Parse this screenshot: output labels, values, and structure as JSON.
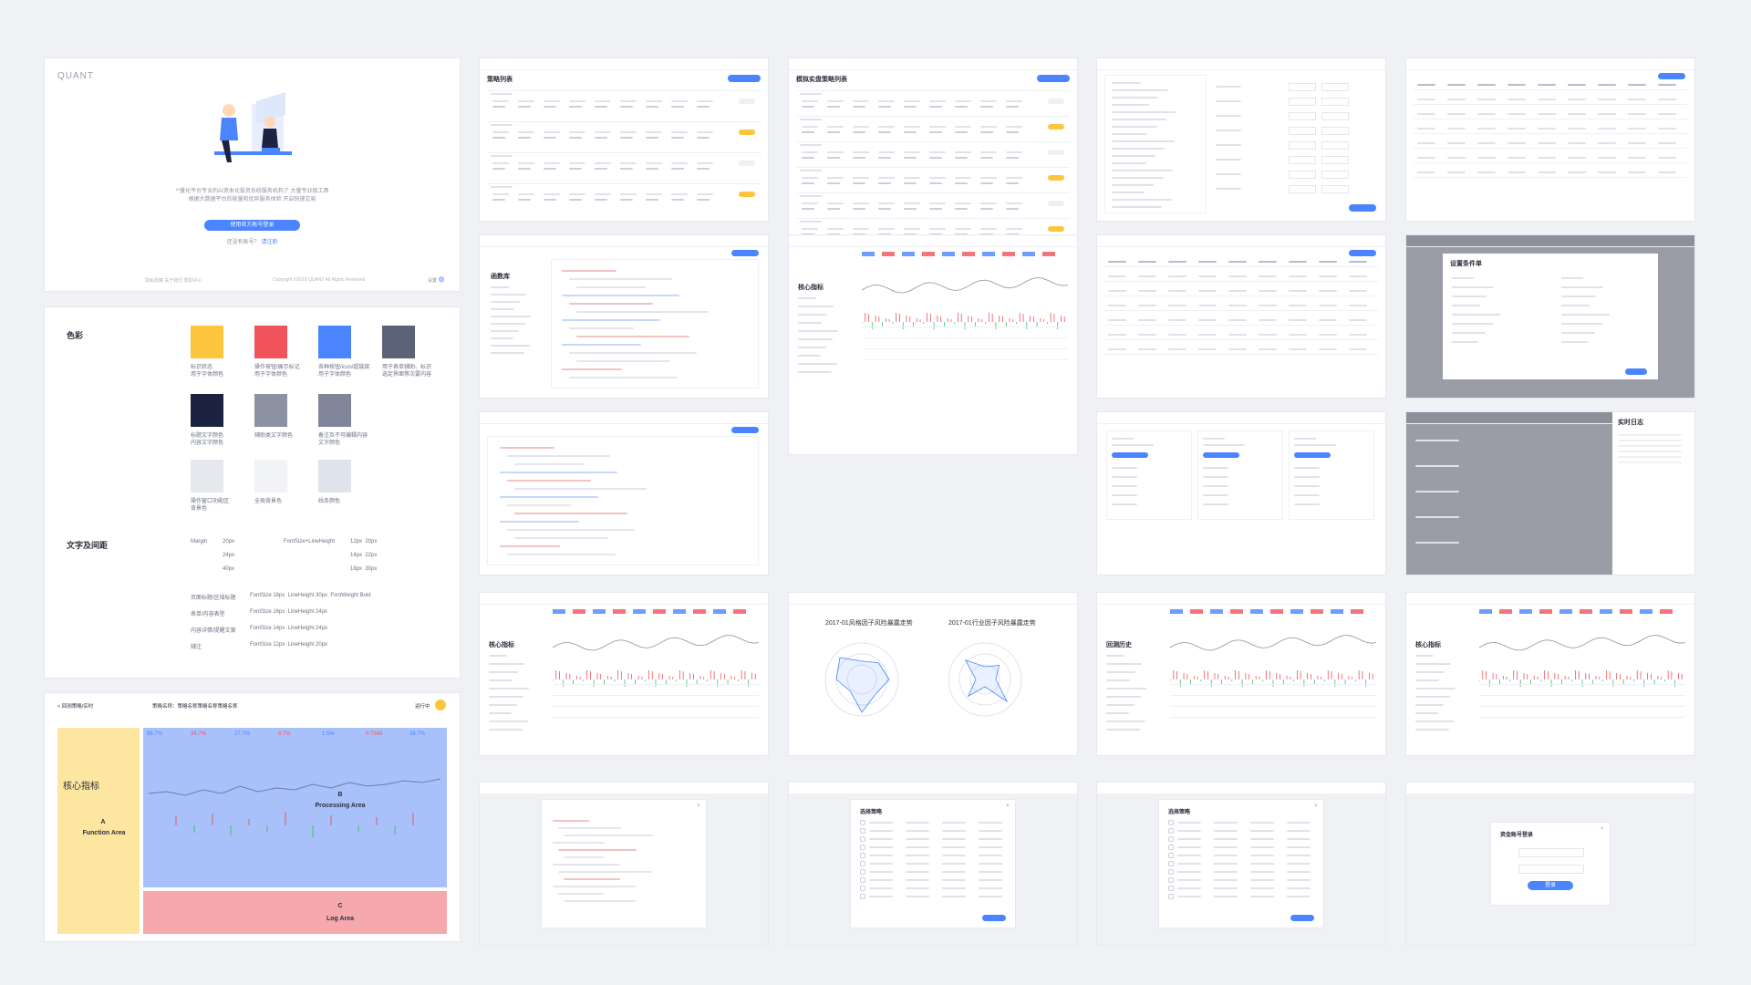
{
  "login": {
    "logo": "QUANT",
    "subtitle_line1": "**量化平台专业的AI资本化投资系统服务机构了 大量专业级工具",
    "subtitle_line2": "根据大数据平台的能量和优异服务体验 开启快速交易",
    "button_label": "使用官方账号登录",
    "register_hint": "还没有账号？",
    "register_link": "请注册",
    "footer_left": "隐私政策  关于我们  帮助中心",
    "footer_center": "Copyright ©2018 QUANT All Rights Reserved",
    "footer_right": "设置"
  },
  "style_guide": {
    "colors_heading": "色彩",
    "typography_heading": "文字及间距",
    "swatches": [
      {
        "color": "#fcc53d",
        "label": "标识状态\n用于字体颜色"
      },
      {
        "color": "#f0535a",
        "label": "操作按钮/展示标记\n用于字体颜色"
      },
      {
        "color": "#4a84ff",
        "label": "各种按钮/icon/超链接\n用于字体颜色"
      },
      {
        "color": "#5c6378",
        "label": "用于表单辅助、标识\n选定界面等次要内容"
      },
      {
        "color": "#1c2340",
        "label": "标题文字颜色\n内容文字颜色"
      },
      {
        "color": "#8d92a2",
        "label": "辅助类文字颜色"
      },
      {
        "color": "#808599",
        "label": "备注及不可编辑内容\n文字颜色"
      },
      {
        "color": "#e6e8ee",
        "label": "操作窗口功能区\n背景色"
      },
      {
        "color": "#f2f3f6",
        "label": "全局背景色"
      },
      {
        "color": "#dfe3ec",
        "label": "线条颜色"
      }
    ],
    "spacing": {
      "margin_label": "Margin",
      "margins": [
        "20px",
        "24px",
        "40px"
      ],
      "fs_label": "FontSize+LineHeight",
      "fs_pairs": [
        "12px  20px",
        "14px  22px",
        "18px  30px"
      ]
    },
    "type_rows": [
      {
        "name": "页面标题/区域标题",
        "spec": "FontSize 18px  LineHeight 30px  FontWeight Bold"
      },
      {
        "name": "表单/内容表型",
        "spec": "FontSize 16px  LineHeight 24px"
      },
      {
        "name": "内容详情/提醒文案",
        "spec": "FontSize 14px  LineHeight 24px"
      },
      {
        "name": "辅注",
        "spec": "FontSize 12px  LineHeight 20px"
      }
    ]
  },
  "areas": {
    "back_label": "< 回测策略/实时",
    "strategy_name": "策略名称：策略名称策略名称策略名称",
    "status": "运行中",
    "a_letter": "A",
    "a_label": "Function Area",
    "a_heading": "核心指标",
    "b_letter": "B",
    "b_label": "Processing Area",
    "c_letter": "C",
    "c_label": "Log Area",
    "stats": [
      "88.7%",
      "34.7%",
      "27.7%",
      "8.7%",
      "1.5%",
      "0.7543",
      "38.7%"
    ]
  },
  "thumbs": {
    "strategy_list_title": "策略列表",
    "sim_list_title": "模拟实盘策略列表",
    "metrics_title": "核心指标",
    "editor_title": "函数库",
    "history_title": "回测历史",
    "radar_title_1": "2017-01风格因子风险暴露走势",
    "radar_title_2": "2017-01行业因子风险暴露走势",
    "dialog_title": "设置条件单",
    "select_title": "选择策略",
    "login_dialog_title": "资金账号登录",
    "login_dialog_btn": "登录",
    "record_title": "回测历史",
    "log_title": "实时日志"
  },
  "icons": {
    "gear": "gear-icon",
    "back": "chevron-left-icon",
    "close": "close-icon"
  }
}
